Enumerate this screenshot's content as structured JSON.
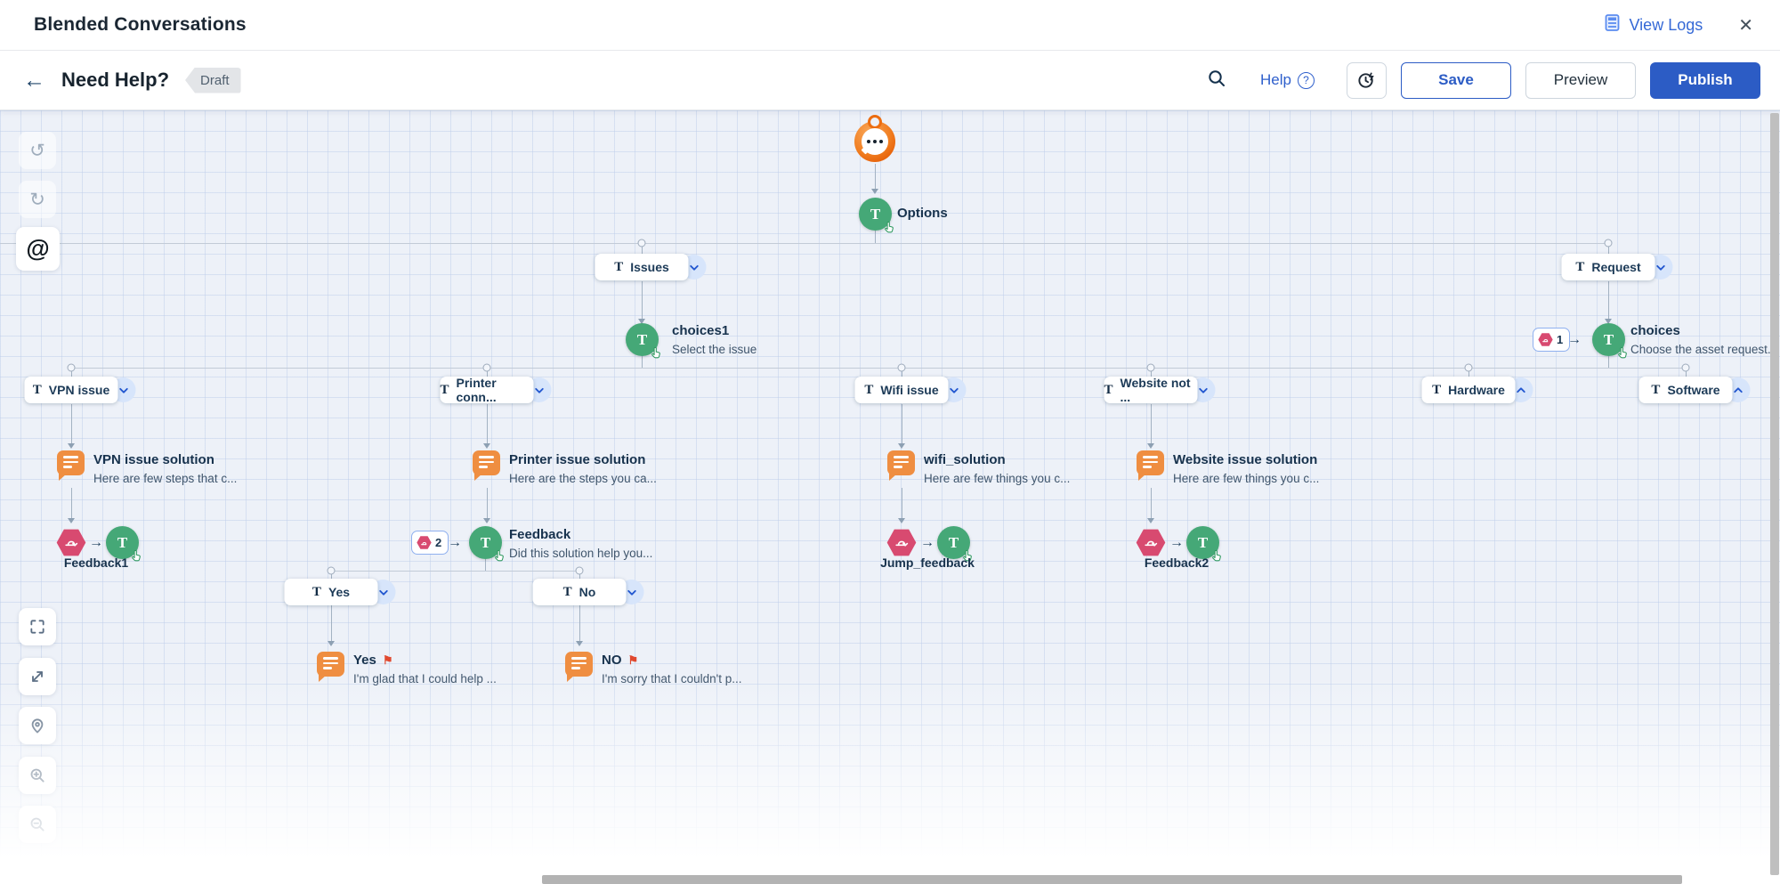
{
  "header": {
    "title": "Blended Conversations",
    "view_logs_label": "View Logs"
  },
  "builder_bar": {
    "flow_name": "Need Help?",
    "status": "Draft",
    "help_label": "Help",
    "save_label": "Save",
    "preview_label": "Preview",
    "publish_label": "Publish"
  },
  "flow": {
    "start": {
      "label": "Options"
    },
    "branches": {
      "issues": {
        "label": "Issues"
      },
      "request": {
        "label": "Request"
      },
      "vpn": {
        "label": "VPN issue"
      },
      "printer": {
        "label": "Printer conn..."
      },
      "wifi": {
        "label": "Wifi issue"
      },
      "website": {
        "label": "Website not ..."
      },
      "hardware": {
        "label": "Hardware"
      },
      "software": {
        "label": "Software"
      },
      "yes": {
        "label": "Yes"
      },
      "no": {
        "label": "No"
      }
    },
    "nodes": {
      "choices1": {
        "title": "choices1",
        "subtitle": "Select the issue"
      },
      "choices": {
        "title": "choices",
        "subtitle": "Choose the asset request...",
        "badge_count": "1"
      },
      "vpn_solution": {
        "title": "VPN issue solution",
        "subtitle": "Here are few steps that c..."
      },
      "printer_solution": {
        "title": "Printer issue solution",
        "subtitle": "Here are the steps you ca..."
      },
      "wifi_solution": {
        "title": "wifi_solution",
        "subtitle": "Here are few things you c..."
      },
      "website_solution": {
        "title": "Website issue solution",
        "subtitle": "Here are few things you c..."
      },
      "feedback1": {
        "title": "Feedback1"
      },
      "feedback": {
        "title": "Feedback",
        "subtitle": "Did this solution help you...",
        "badge_count": "2"
      },
      "jump_feedback": {
        "title": "Jump_feedback"
      },
      "feedback2": {
        "title": "Feedback2"
      },
      "yes_message": {
        "title": "Yes",
        "subtitle": "I'm glad that I could help ..."
      },
      "no_message": {
        "title": "NO",
        "subtitle": "I'm sorry that I couldn't p..."
      }
    }
  },
  "icons": {
    "back": "←",
    "close": "✕",
    "mention": "@",
    "undo": "↺",
    "redo": "↻",
    "type_glyph": "T",
    "flow_arrow": "→",
    "flag": "⚑",
    "help_q": "?"
  },
  "colors": {
    "accent_blue": "#2c5cc5",
    "node_green": "#45a877",
    "message_orange": "#ef8e41",
    "action_pink": "#d84a70",
    "flag_red": "#e0492f",
    "canvas_bg": "#edf1f8"
  }
}
